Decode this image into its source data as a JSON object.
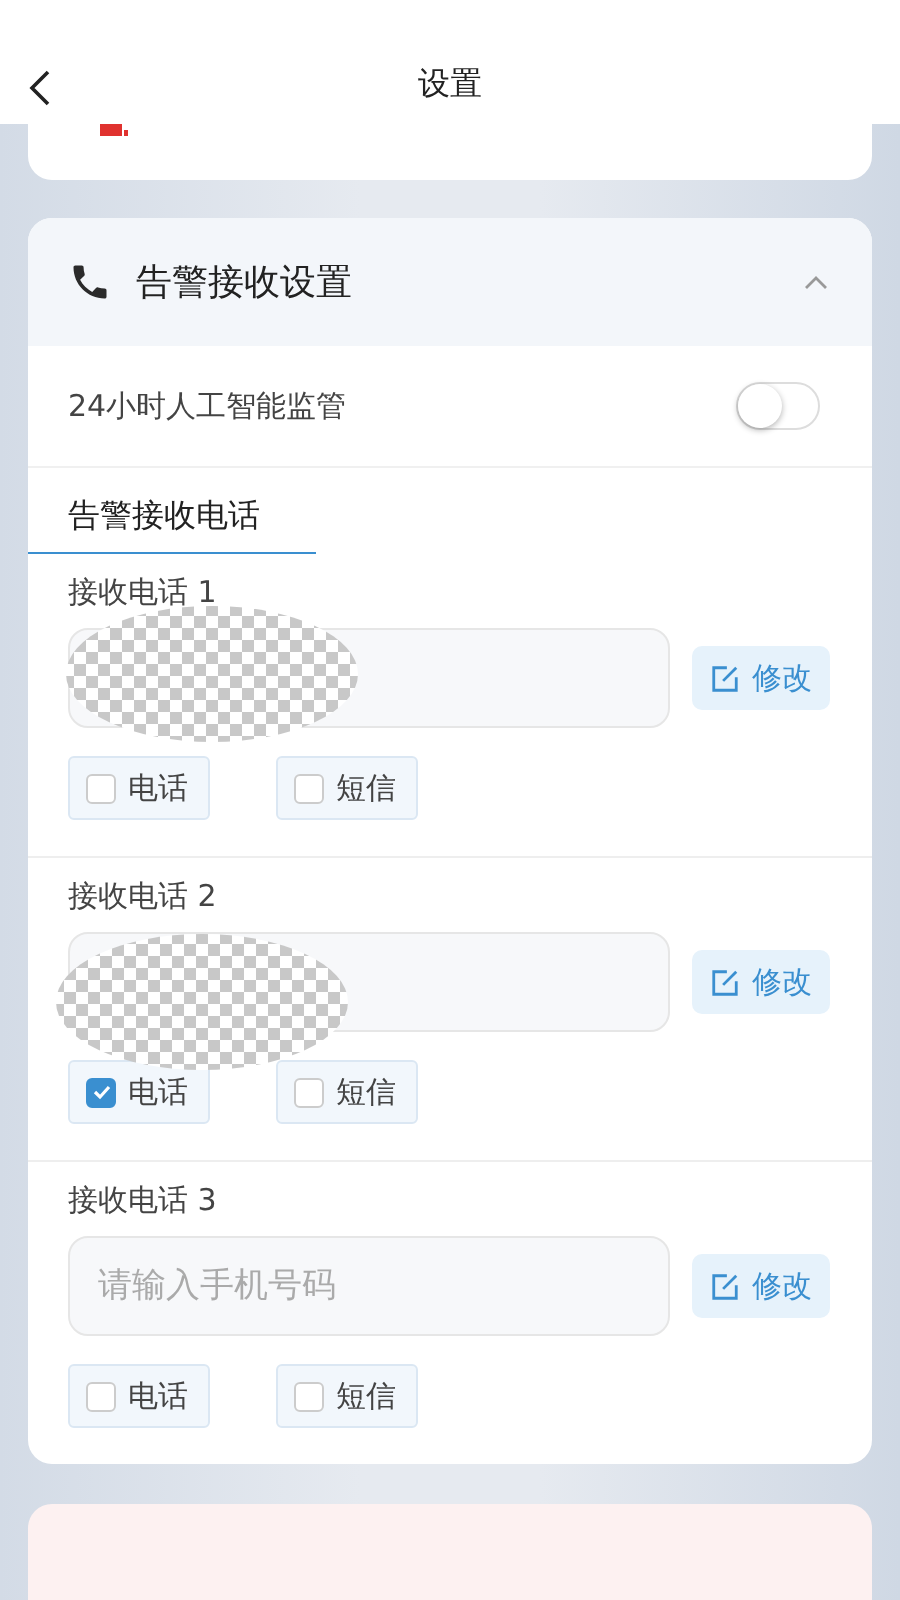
{
  "header": {
    "title": "设置"
  },
  "section": {
    "title": "告警接收设置",
    "expanded": true,
    "ai_monitor": {
      "label": "24小时人工智能监管",
      "on": false
    },
    "tab": {
      "label": "告警接收电话",
      "selected": true
    },
    "phones": [
      {
        "label": "接收电话 1",
        "redacted": true,
        "button": "修改",
        "options": [
          {
            "label": "电话",
            "checked": false
          },
          {
            "label": "短信",
            "checked": false
          }
        ]
      },
      {
        "label": "接收电话 2",
        "redacted": true,
        "button": "修改",
        "options": [
          {
            "label": "电话",
            "checked": true
          },
          {
            "label": "短信",
            "checked": false
          }
        ]
      },
      {
        "label": "接收电话 3",
        "redacted": false,
        "placeholder": "请输入手机号码",
        "button": "修改",
        "options": [
          {
            "label": "电话",
            "checked": false
          },
          {
            "label": "短信",
            "checked": false
          }
        ]
      }
    ]
  }
}
